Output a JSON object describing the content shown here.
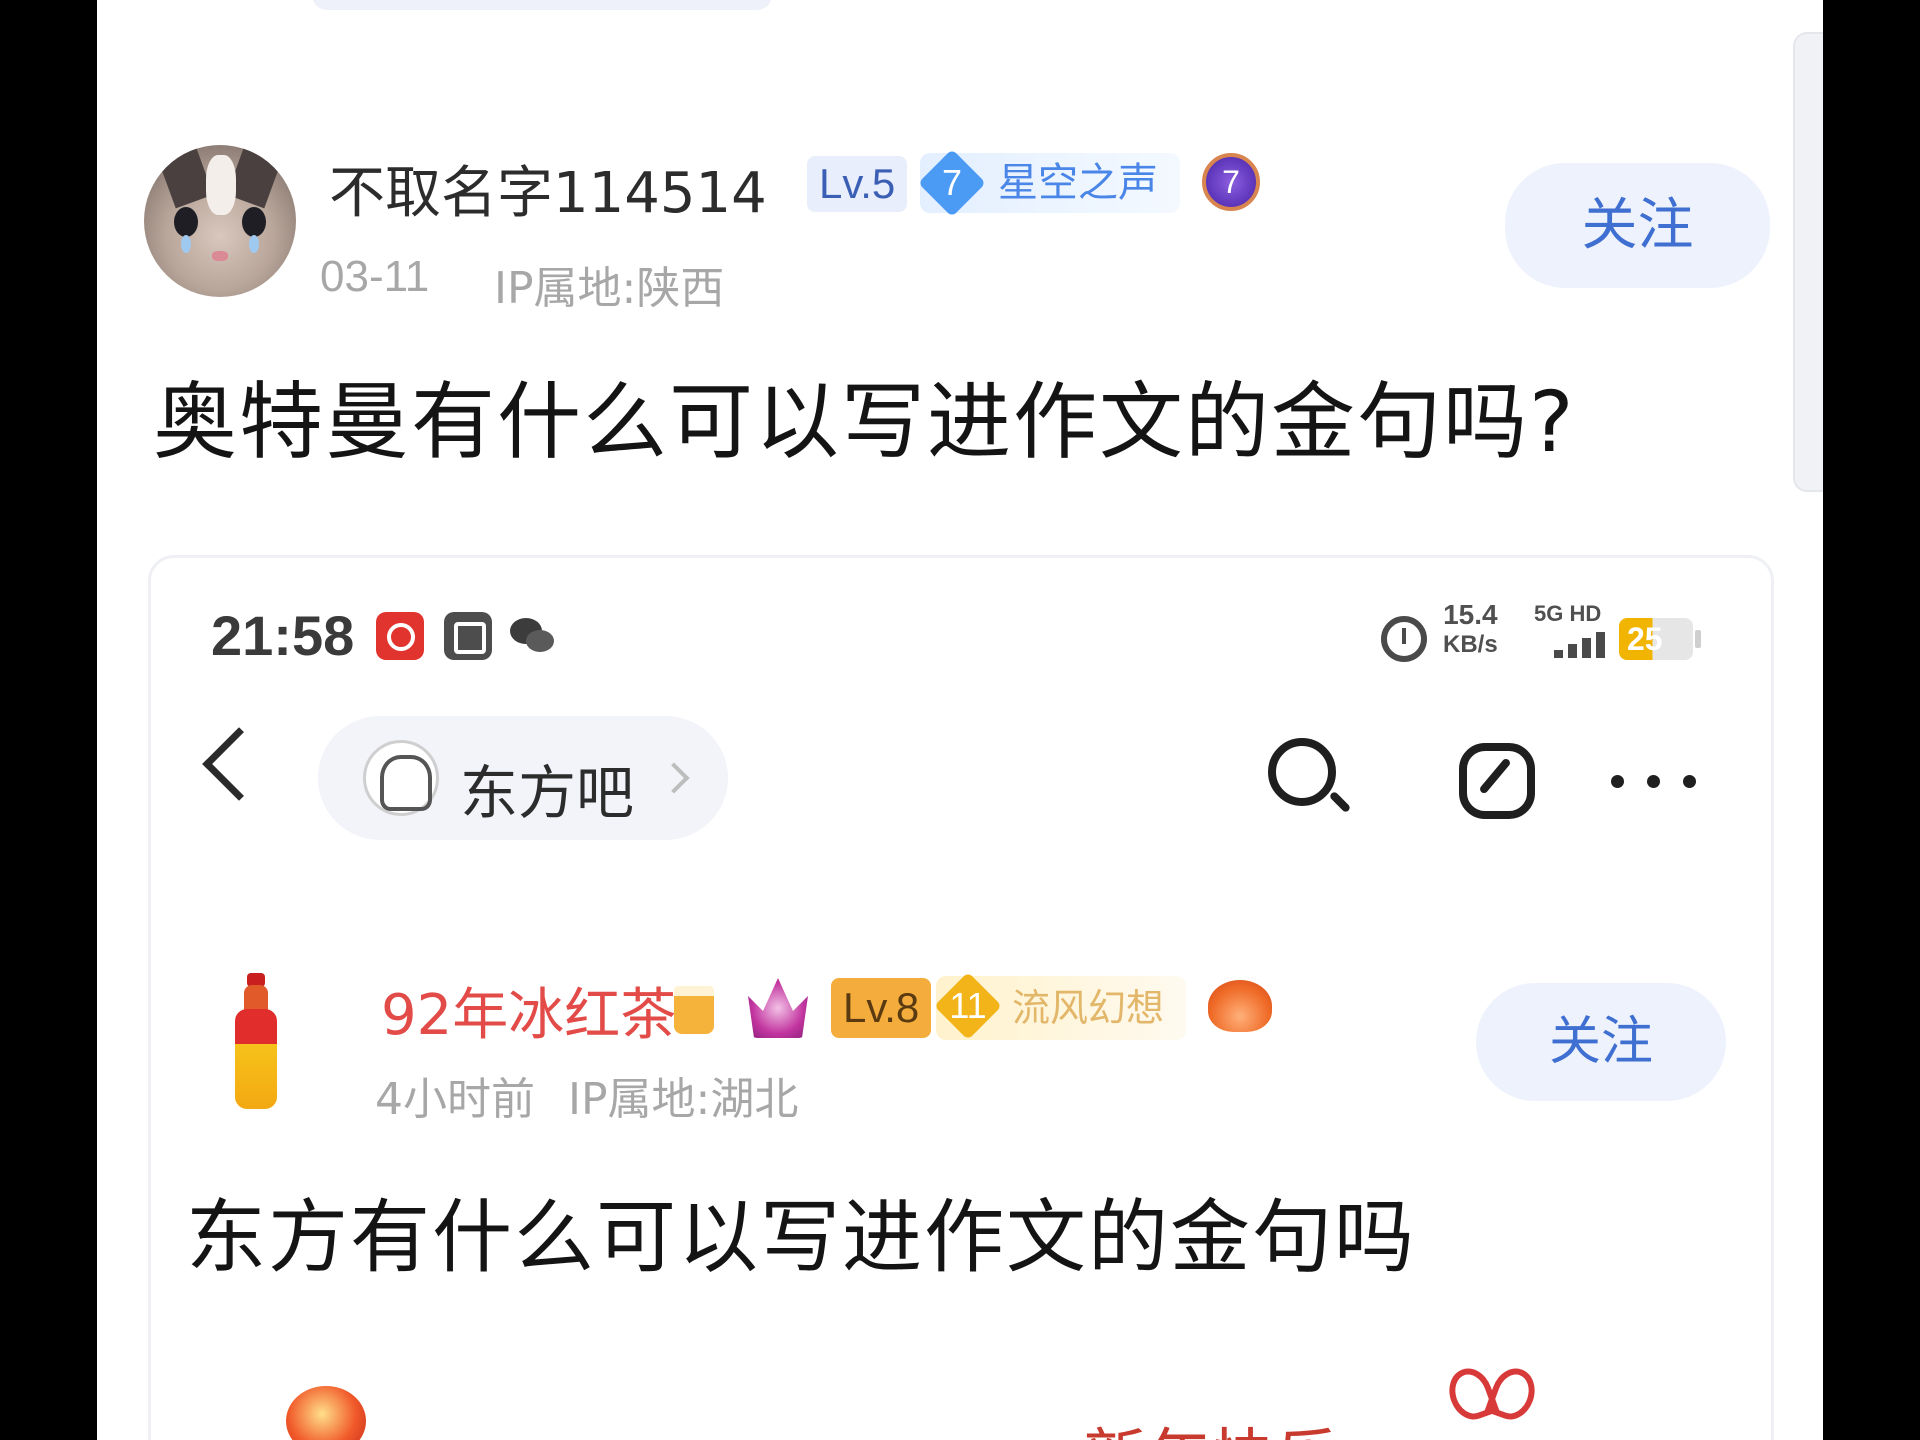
{
  "outer_post": {
    "username": "不取名字114514",
    "level": "Lv.5",
    "badge_number": "7",
    "badge_title": "星空之声",
    "purple_badge_number": "7",
    "date": "03-11",
    "ip": "IP属地:陕西",
    "follow_label": "关注",
    "title": "奥特曼有什么可以写进作文的金句吗?"
  },
  "embedded": {
    "status_bar": {
      "time": "21:58",
      "speed_value": "15.4",
      "speed_unit": "KB/s",
      "network": "5G HD",
      "battery": "25"
    },
    "nav": {
      "forum_name": "东方吧"
    },
    "post": {
      "username": "92年冰红茶",
      "level": "Lv.8",
      "badge_number": "11",
      "badge_title": "流风幻想",
      "time": "4小时前",
      "ip": "IP属地:湖北",
      "follow_label": "关注",
      "title": "东方有什么可以写进作文的金句吗"
    },
    "peek_text": "新年快乐"
  },
  "colors": {
    "accent_blue": "#3f6fd1",
    "username_red": "#e24b47",
    "meta_gray": "#a7a7a7"
  }
}
